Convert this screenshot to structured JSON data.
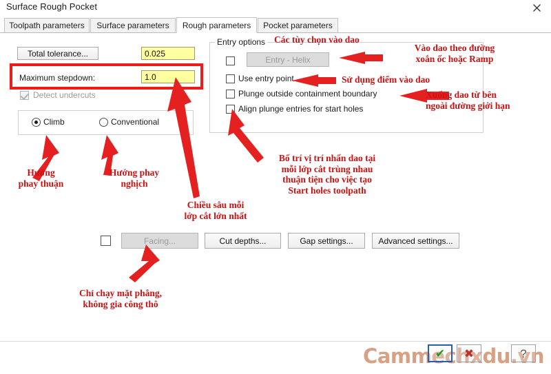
{
  "window": {
    "title": "Surface Rough Pocket",
    "close_icon": "close-icon"
  },
  "tabs": [
    {
      "label": "Toolpath parameters",
      "active": false
    },
    {
      "label": "Surface parameters",
      "active": false
    },
    {
      "label": "Rough parameters",
      "active": true
    },
    {
      "label": "Pocket parameters",
      "active": false
    }
  ],
  "left_panel": {
    "total_tolerance_button": "Total tolerance...",
    "total_tolerance_value": "0.025",
    "maximum_stepdown_label": "Maximum stepdown:",
    "maximum_stepdown_value": "1.0",
    "detect_undercuts_label": "Detect undercuts",
    "detect_undercuts_checked": true,
    "cut_direction": {
      "climb_label": "Climb",
      "conventional_label": "Conventional",
      "selected": "Climb"
    }
  },
  "entry_options": {
    "group_title": "Entry options",
    "entry_helix_button": "Entry - Helix",
    "entry_helix_checked": false,
    "items": [
      {
        "label": "Use entry point",
        "checked": false
      },
      {
        "label": "Plunge outside containment boundary",
        "checked": false
      },
      {
        "label": "Align plunge entries for start holes",
        "checked": false
      }
    ]
  },
  "bottom_bar": {
    "facing_checkbox_checked": false,
    "facing_button": "Facing...",
    "cut_depths_button": "Cut depths...",
    "gap_settings_button": "Gap settings...",
    "advanced_settings_button": "Advanced settings..."
  },
  "annotations": {
    "entry_options_title": "Các tùy chọn vào dao",
    "entry_helix": "Vào dao theo đường\nxoắn ốc hoặc Ramp",
    "use_entry_point": "Sử dụng điểm vào dao",
    "plunge_outside": "Xuống dao từ bên\nngoài đường giới hạn",
    "align_plunge": "Bố trí vị trí nhấn dao tại\nmỗi lớp cắt trùng nhau\nthuận tiện cho việc tạo\nStart holes toolpath",
    "climb": "Hướng\nphay thuận",
    "conventional": "Hướng phay\nnghịch",
    "max_stepdown": "Chiều sâu mỗi\nlớp cắt lớn nhất",
    "facing": "Chỉ chạy mặt phẳng,\nkhông gia công thô"
  },
  "watermark": {
    "text": "Cammechxdu.vn",
    "buttons": [
      {
        "icon": "checkmark-icon",
        "glyph": "✔",
        "color": "#1f9a1f",
        "primary": true
      },
      {
        "icon": "cross-icon",
        "glyph": "✖",
        "color": "#c03030",
        "primary": false
      },
      {
        "icon": "question-mark-icon",
        "glyph": "?",
        "color": "#555555",
        "primary": false
      }
    ]
  },
  "colors": {
    "annotation_red": "#cc1111",
    "arrow_red": "#ee1b1b",
    "field_yellow": "#ffffa0"
  }
}
